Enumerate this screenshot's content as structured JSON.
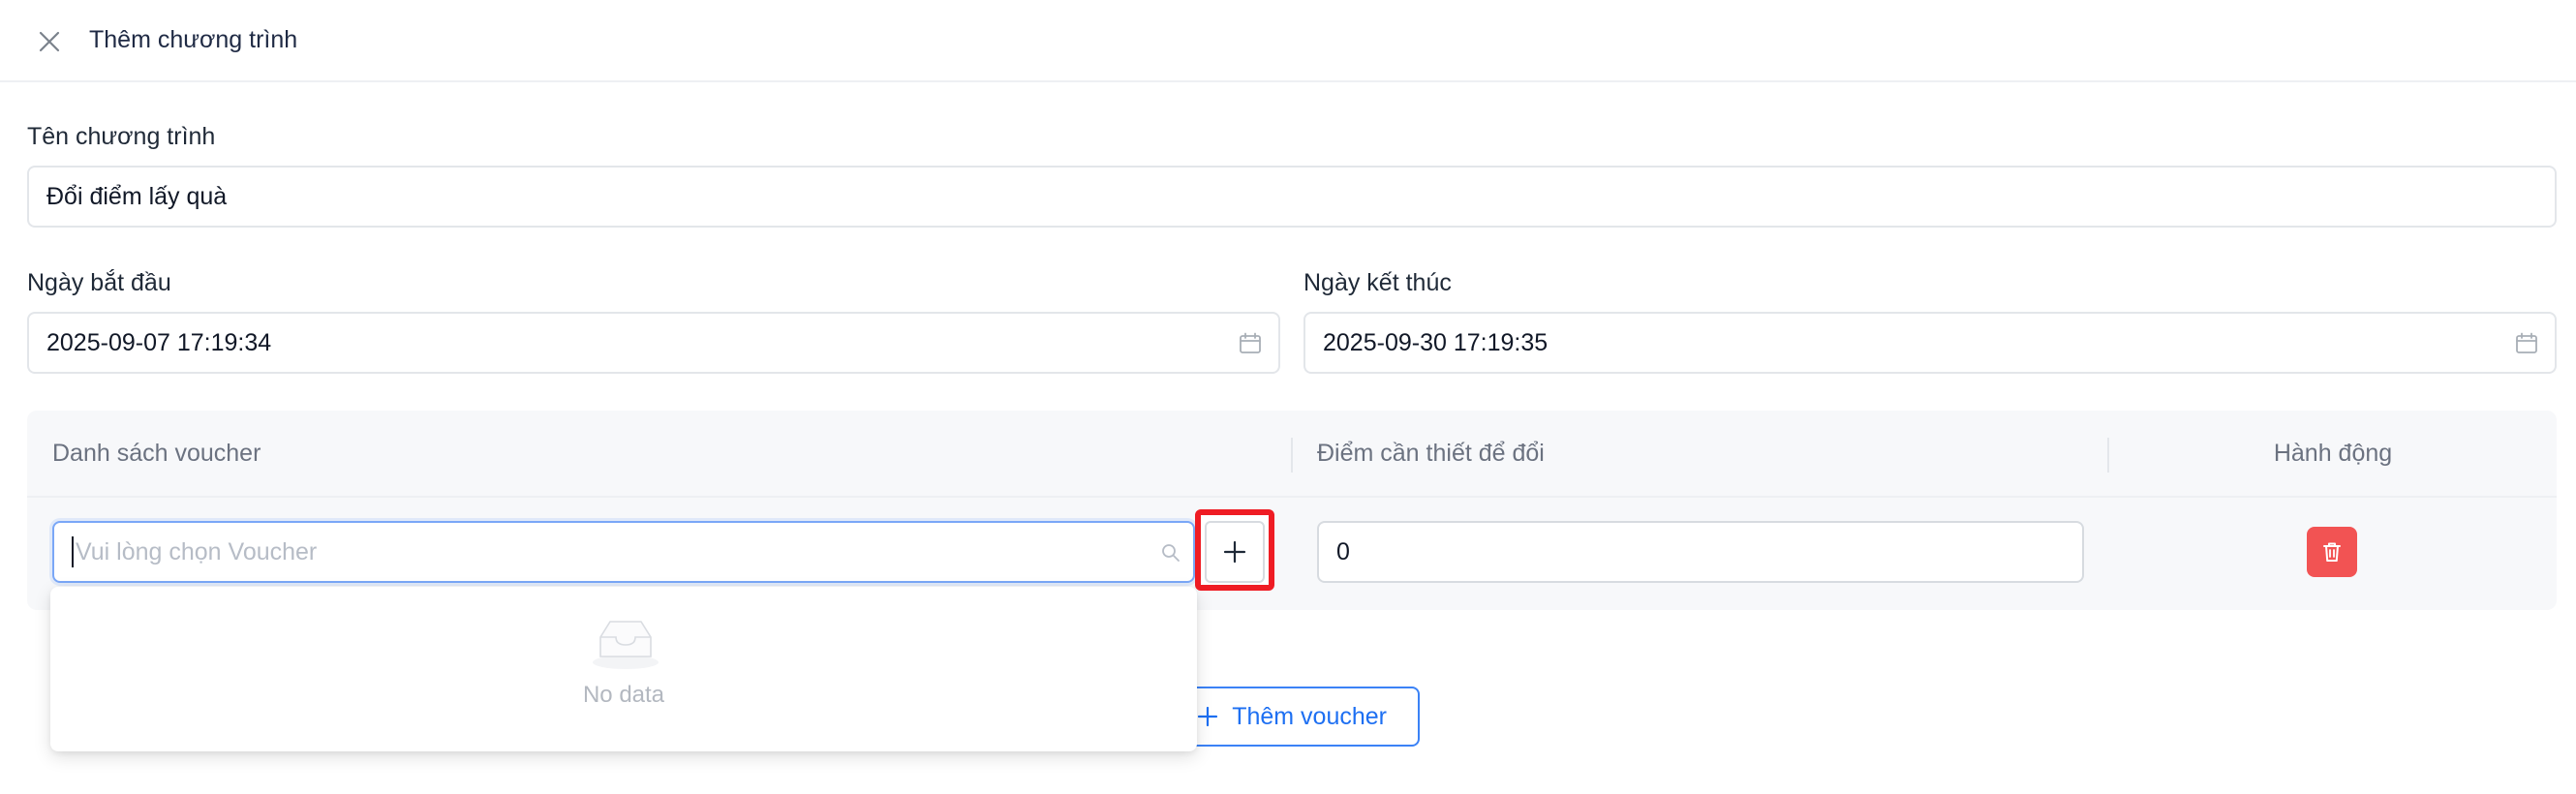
{
  "header": {
    "title": "Thêm chương trình"
  },
  "form": {
    "name_label": "Tên chương trình",
    "name_value": "Đổi điểm lấy quà",
    "start_label": "Ngày bắt đầu",
    "start_value": "2025-09-07 17:19:34",
    "end_label": "Ngày kết thúc",
    "end_value": "2025-09-30 17:19:35"
  },
  "table": {
    "columns": [
      "Danh sách voucher",
      "Điểm cần thiết để đổi",
      "Hành động"
    ],
    "row": {
      "voucher_placeholder": "Vui lòng chọn Voucher",
      "points_value": "0"
    }
  },
  "dropdown": {
    "empty_text": "No data"
  },
  "add_voucher": {
    "label": "Thêm voucher"
  },
  "colors": {
    "accent": "#1d6ff2",
    "danger": "#f25353",
    "highlight": "#ef1c24"
  }
}
